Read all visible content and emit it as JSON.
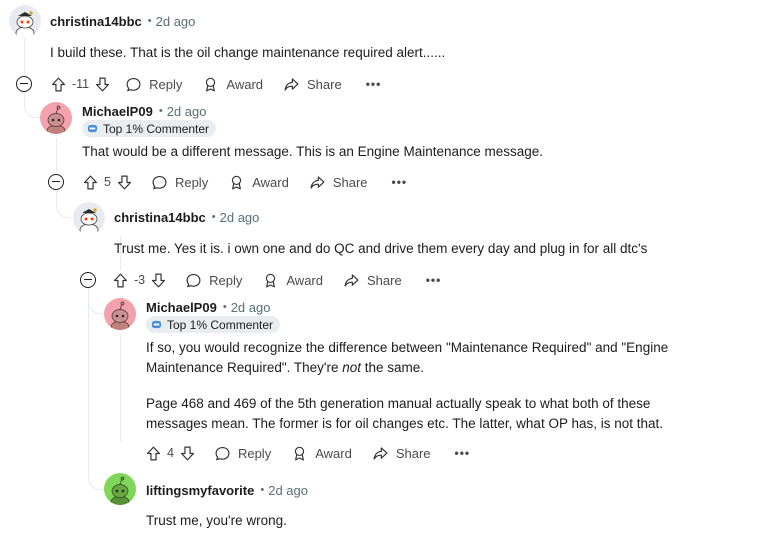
{
  "comments": [
    {
      "author": "christina14bbc",
      "age": "2d ago",
      "paragraphs": [
        "I build these. That is the oil change maintenance required alert......"
      ],
      "votes": "-11",
      "reply_label": "Reply",
      "award_label": "Award",
      "share_label": "Share",
      "more_label": "•••"
    },
    {
      "author": "MichaelP09",
      "age": "2d ago",
      "flair": "Top 1% Commenter",
      "paragraphs": [
        "That would be a different message. This is an Engine Maintenance message."
      ],
      "votes": "5",
      "reply_label": "Reply",
      "award_label": "Award",
      "share_label": "Share",
      "more_label": "•••"
    },
    {
      "author": "christina14bbc",
      "age": "2d ago",
      "paragraphs": [
        "Trust me. Yes it is. i own one and do QC and drive them every day and plug in for all dtc's"
      ],
      "votes": "-3",
      "reply_label": "Reply",
      "award_label": "Award",
      "share_label": "Share",
      "more_label": "•••"
    },
    {
      "author": "MichaelP09",
      "age": "2d ago",
      "flair": "Top 1% Commenter",
      "paragraph1_a": "If so, you would recognize the difference between \"Maintenance Required\" and \"Engine Maintenance Required\". They're ",
      "paragraph1_em": "not",
      "paragraph1_b": " the same.",
      "paragraph2": "Page 468 and 469 of the 5th generation manual actually speak to what both of these messages mean. The former is for oil changes etc. The latter, what OP has, is not that.",
      "votes": "4",
      "reply_label": "Reply",
      "award_label": "Award",
      "share_label": "Share",
      "more_label": "•••"
    },
    {
      "author": "liftingsmyfavorite",
      "age": "2d ago",
      "paragraphs": [
        "Trust me, you're wrong."
      ]
    }
  ],
  "meta_separator": "•",
  "colors": {
    "text": "#1c1c1c",
    "muted": "#576f76",
    "thread": "#e5ebee",
    "flair_bg": "#eaedef"
  },
  "icons": [
    "snoo-avatar-icon",
    "upvote-icon",
    "downvote-icon",
    "reply-icon",
    "award-icon",
    "share-icon",
    "collapse-icon",
    "flair-badge-icon"
  ]
}
